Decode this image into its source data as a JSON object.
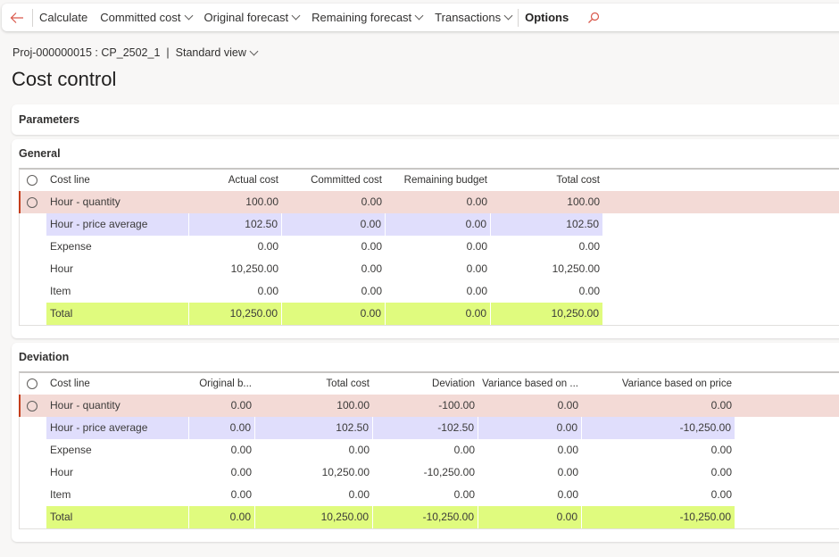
{
  "actionpane": {
    "back_icon": "back-arrow-icon",
    "calculate": "Calculate",
    "committed_cost": "Committed cost",
    "original_forecast": "Original forecast",
    "remaining_forecast": "Remaining forecast",
    "transactions": "Transactions",
    "options": "Options",
    "search_icon": "search-icon"
  },
  "header": {
    "record": "Proj-000000015 : CP_2502_1",
    "separator": "|",
    "view": "Standard view",
    "title": "Cost control"
  },
  "colors": {
    "selected_row": "#f3dad6",
    "selected_accent": "#c43e1c",
    "highlight_purple": "#e0defc",
    "highlight_green": "#e0fb7e",
    "back_icon": "#d9574a"
  },
  "parameters": {
    "title": "Parameters"
  },
  "general": {
    "title": "General",
    "columns": [
      "Cost line",
      "Actual cost",
      "Committed cost",
      "Remaining budget",
      "Total cost"
    ],
    "rows": [
      {
        "cells": [
          "Hour - quantity",
          "100.00",
          "0.00",
          "0.00",
          "100.00"
        ]
      },
      {
        "cells": [
          "Hour - price average",
          "102.50",
          "0.00",
          "0.00",
          "102.50"
        ]
      },
      {
        "cells": [
          "Expense",
          "0.00",
          "0.00",
          "0.00",
          "0.00"
        ]
      },
      {
        "cells": [
          "Hour",
          "10,250.00",
          "0.00",
          "0.00",
          "10,250.00"
        ]
      },
      {
        "cells": [
          "Item",
          "0.00",
          "0.00",
          "0.00",
          "0.00"
        ]
      },
      {
        "cells": [
          "Total",
          "10,250.00",
          "0.00",
          "0.00",
          "10,250.00"
        ]
      }
    ]
  },
  "deviation": {
    "title": "Deviation",
    "columns": [
      "Cost line",
      "Original b...",
      "Total cost",
      "Deviation",
      "Variance based on ...",
      "Variance based on price"
    ],
    "rows": [
      {
        "cells": [
          "Hour - quantity",
          "0.00",
          "100.00",
          "-100.00",
          "0.00",
          "0.00"
        ]
      },
      {
        "cells": [
          "Hour - price average",
          "0.00",
          "102.50",
          "-102.50",
          "0.00",
          "-10,250.00"
        ]
      },
      {
        "cells": [
          "Expense",
          "0.00",
          "0.00",
          "0.00",
          "0.00",
          "0.00"
        ]
      },
      {
        "cells": [
          "Hour",
          "0.00",
          "10,250.00",
          "-10,250.00",
          "0.00",
          "0.00"
        ]
      },
      {
        "cells": [
          "Item",
          "0.00",
          "0.00",
          "0.00",
          "0.00",
          "0.00"
        ]
      },
      {
        "cells": [
          "Total",
          "0.00",
          "10,250.00",
          "-10,250.00",
          "0.00",
          "-10,250.00"
        ]
      }
    ]
  }
}
